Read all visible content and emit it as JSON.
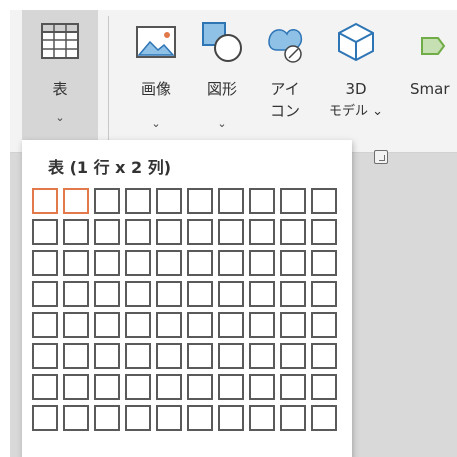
{
  "ribbon": {
    "table_button": {
      "label": "表",
      "caret": "⌄"
    },
    "picture_button": {
      "label": "画像",
      "caret": "⌄"
    },
    "shapes_button": {
      "label": "図形",
      "caret": "⌄"
    },
    "icons_button": {
      "label_line1": "アイ",
      "label_line2": "コン"
    },
    "model3d_button": {
      "label_line1": "3D",
      "label_line2": "モデル ⌄"
    },
    "smartart_button": {
      "label": "Smar"
    }
  },
  "table_dropdown": {
    "title": "表 (1 行 x 2 列)",
    "grid": {
      "rows": 8,
      "cols": 10,
      "selected_rows": 1,
      "selected_cols": 2
    }
  },
  "colors": {
    "selected_cell": "#e2794a",
    "cell": "#5a5a5a",
    "accent": "#2e75b6"
  }
}
